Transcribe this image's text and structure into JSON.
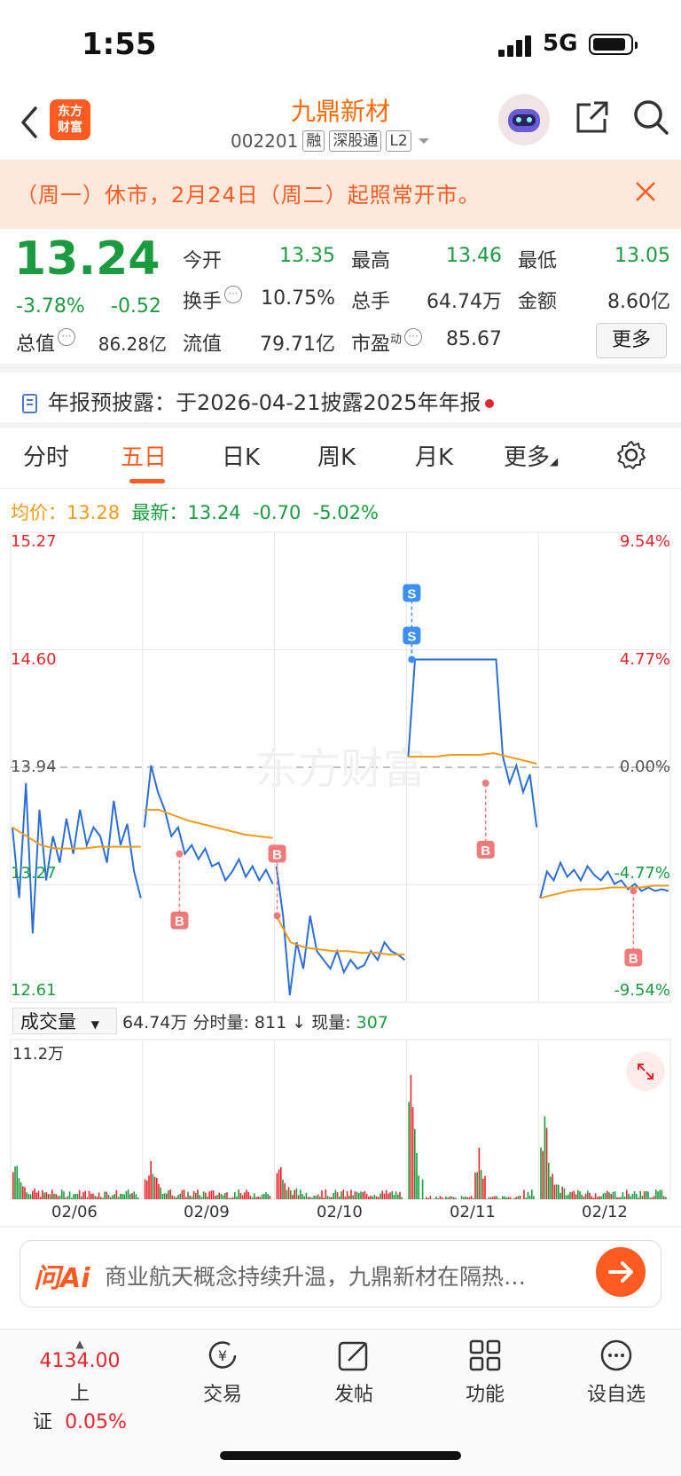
{
  "status_bar": {
    "time": "1:55",
    "network": "5G"
  },
  "header": {
    "logo_line1": "东方",
    "logo_line2": "财富",
    "stock_name": "九鼎新材",
    "stock_code": "002201",
    "tags": [
      "融",
      "深股通",
      "L2"
    ]
  },
  "notice": {
    "text": "（周一）休市，2月24日（周二）起照常开市。"
  },
  "quote": {
    "price": "13.24",
    "change_pct": "-3.78%",
    "change": "-0.52",
    "open_label": "今开",
    "open": "13.35",
    "high_label": "最高",
    "high": "13.46",
    "low_label": "最低",
    "low": "13.05",
    "turnover_label": "换手",
    "turnover": "10.75%",
    "volume_label": "总手",
    "volume": "64.74万",
    "amount_label": "金额",
    "amount": "8.60亿",
    "mcap_label": "总值",
    "mcap": "86.28亿",
    "float_label": "流值",
    "float": "79.71亿",
    "pe_label": "市盈",
    "pe_sup": "动",
    "pe": "85.67",
    "more": "更多"
  },
  "report": {
    "text": "年报预披露：于2026-04-21披露2025年年报"
  },
  "tabs": [
    "分时",
    "五日",
    "日K",
    "周K",
    "月K",
    "更多"
  ],
  "active_tab": "五日",
  "chart_legend": {
    "avg_label": "均价：",
    "avg": "13.28",
    "latest_label": "最新：",
    "latest": "13.24",
    "chg": "-0.70",
    "pct": "-5.02%"
  },
  "chart_data": {
    "type": "line",
    "y_labels_left": [
      "15.27",
      "14.60",
      "13.94",
      "13.27",
      "12.61"
    ],
    "y_labels_right": [
      "9.54%",
      "4.77%",
      "0.00%",
      "-4.77%",
      "-9.54%"
    ],
    "ylim": [
      12.61,
      15.27
    ],
    "baseline": 13.94,
    "x_labels": [
      "02/06",
      "02/09",
      "02/10",
      "02/11",
      "02/12"
    ],
    "watermark": "东方财富",
    "series": [
      {
        "values": [
          13.6,
          13.2,
          13.85,
          13.0,
          13.7,
          13.3,
          13.55,
          13.4,
          13.65,
          13.45,
          13.7,
          13.5,
          13.6,
          13.55,
          13.4,
          13.75,
          13.5,
          13.62,
          13.35,
          13.2
        ]
      },
      {
        "values": [
          13.6,
          13.95,
          13.8,
          13.7,
          13.55,
          13.6,
          13.45,
          13.5,
          13.42,
          13.48,
          13.38,
          13.4,
          13.3,
          13.35,
          13.42,
          13.32,
          13.38,
          13.3,
          13.36,
          13.28
        ]
      },
      {
        "values": [
          13.38,
          13.1,
          12.65,
          12.95,
          12.8,
          13.1,
          12.9,
          12.85,
          12.8,
          12.9,
          12.78,
          12.85,
          12.8,
          12.82,
          12.9,
          12.85,
          12.95,
          12.9,
          12.88,
          12.85
        ]
      },
      {
        "values": [
          14.0,
          14.55,
          14.55,
          14.55,
          14.55,
          14.55,
          14.55,
          14.55,
          14.55,
          14.55,
          14.55,
          14.55,
          14.55,
          14.55,
          14.0,
          13.85,
          13.95,
          13.8,
          13.9,
          13.6
        ]
      },
      {
        "values": [
          13.2,
          13.35,
          13.3,
          13.4,
          13.32,
          13.36,
          13.3,
          13.38,
          13.33,
          13.3,
          13.35,
          13.28,
          13.3,
          13.25,
          13.28,
          13.24,
          13.26,
          13.24,
          13.25,
          13.24
        ]
      }
    ],
    "avg_series": [
      {
        "values": [
          13.6,
          13.55,
          13.5,
          13.48,
          13.48,
          13.48,
          13.49,
          13.49,
          13.49,
          13.49
        ]
      },
      {
        "values": [
          13.7,
          13.7,
          13.67,
          13.64,
          13.62,
          13.6,
          13.58,
          13.56,
          13.55,
          13.54
        ]
      },
      {
        "values": [
          13.1,
          12.95,
          12.92,
          12.91,
          12.9,
          12.9,
          12.89,
          12.89,
          12.88,
          12.88
        ]
      },
      {
        "values": [
          14.0,
          14.0,
          14.0,
          14.01,
          14.01,
          14.01,
          14.02,
          14.0,
          13.98,
          13.96
        ]
      },
      {
        "values": [
          13.2,
          13.22,
          13.24,
          13.25,
          13.25,
          13.26,
          13.26,
          13.26,
          13.27,
          13.27
        ]
      }
    ],
    "markers": [
      "S",
      "S",
      "B",
      "B",
      "B",
      "B"
    ],
    "volume": {
      "label": "成交量",
      "total": "64.74万",
      "fenshi_label": "分时量:",
      "fenshi": "811",
      "arrow": "↓",
      "current_label": "现量:",
      "current": "307",
      "ymax_label": "11.2万",
      "peaks": [
        3,
        2.8,
        2.5,
        11.2,
        3.5,
        7
      ]
    }
  },
  "ask_ai": {
    "logo": "问Ai",
    "text": "商业航天概念持续升温，九鼎新材在隔热…"
  },
  "bottom_nav": {
    "index_value": "4134.00",
    "index_name": "上证",
    "index_pct": "0.05%",
    "items": [
      "交易",
      "发帖",
      "功能",
      "设自选"
    ]
  }
}
